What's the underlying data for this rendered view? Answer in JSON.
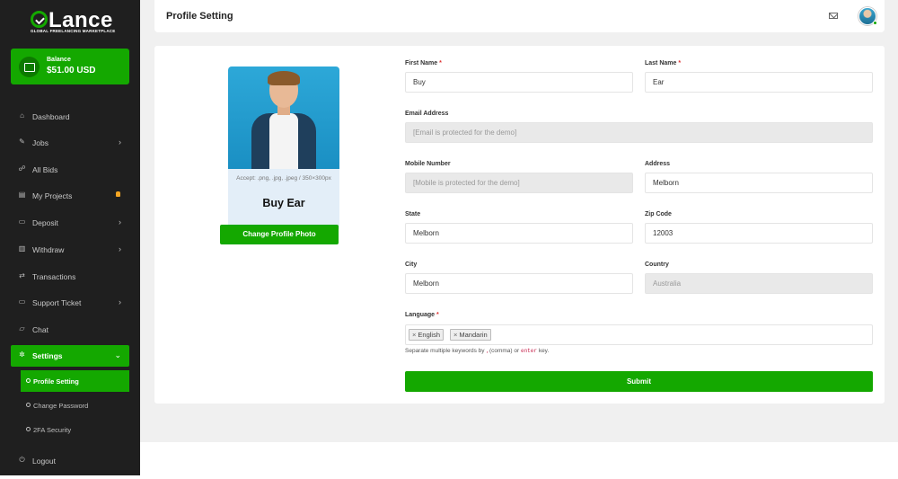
{
  "brand": {
    "logo_text": "Lance",
    "tagline": "GLOBAL FREELANCING MARKETPLACE",
    "accent": "#14a800"
  },
  "balance": {
    "label": "Balance",
    "amount": "$51.00 USD"
  },
  "sidebar": {
    "items": [
      {
        "label": "Dashboard",
        "icon": "home-icon"
      },
      {
        "label": "Jobs",
        "icon": "pencil-icon"
      },
      {
        "label": "All Bids",
        "icon": "users-icon"
      },
      {
        "label": "My Projects",
        "icon": "briefcase-icon"
      },
      {
        "label": "Deposit",
        "icon": "wallet-icon"
      },
      {
        "label": "Withdraw",
        "icon": "bank-icon"
      },
      {
        "label": "Transactions",
        "icon": "exchange-icon"
      },
      {
        "label": "Support Ticket",
        "icon": "ticket-icon"
      },
      {
        "label": "Chat",
        "icon": "chat-icon"
      },
      {
        "label": "Settings",
        "icon": "gear-icon"
      },
      {
        "label": "Logout",
        "icon": "logout-icon"
      }
    ],
    "settings_sub": [
      {
        "label": "Profile Setting"
      },
      {
        "label": "Change Password"
      },
      {
        "label": "2FA Security"
      }
    ]
  },
  "header": {
    "title": "Profile Setting"
  },
  "profile": {
    "accept_text": "Accept: .png, .jpg, .jpeg / 350×300px",
    "name": "Buy Ear",
    "change_photo_label": "Change Profile Photo"
  },
  "form": {
    "first_name": {
      "label": "First Name",
      "value": "Buy"
    },
    "last_name": {
      "label": "Last Name",
      "value": "Ear"
    },
    "email": {
      "label": "Email Address",
      "value": "[Email is protected for the demo]"
    },
    "mobile": {
      "label": "Mobile Number",
      "value": "[Mobile is protected for the demo]"
    },
    "address": {
      "label": "Address",
      "value": "Melborn"
    },
    "state": {
      "label": "State",
      "value": "Melborn"
    },
    "zip": {
      "label": "Zip Code",
      "value": "12003"
    },
    "city": {
      "label": "City",
      "value": "Melborn"
    },
    "country": {
      "label": "Country",
      "value": "Australia"
    },
    "language": {
      "label": "Language",
      "tags": [
        "English",
        "Mandarin"
      ]
    },
    "help": {
      "prefix": "Separate multiple keywords by",
      "comma": ",",
      "middle": "(comma) or",
      "enter": "enter",
      "suffix": "key."
    },
    "required_mark": "*",
    "tag_remove": "×",
    "submit_label": "Submit"
  }
}
